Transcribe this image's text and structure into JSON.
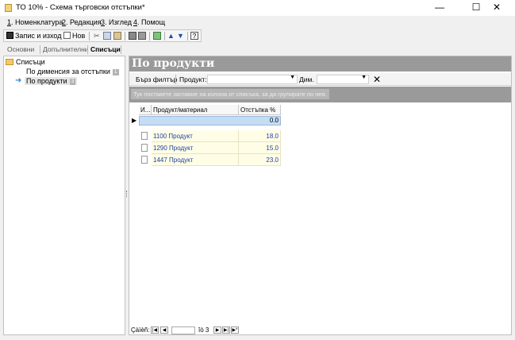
{
  "window": {
    "title": "ТО 10% - Схема търговски отстъпки*"
  },
  "menu": [
    {
      "key": "1",
      "label": ". Номенклатура"
    },
    {
      "key": "2",
      "label": ". Редакция"
    },
    {
      "key": "3",
      "label": ". Изглед"
    },
    {
      "key": "4",
      "label": ". Помощ"
    }
  ],
  "toolbar": {
    "save_label": "Запис и изход",
    "new_label": "Нов"
  },
  "tabs": {
    "basic": "Основни",
    "additional": "Допълнителни",
    "lists": "Списъци"
  },
  "tree": {
    "root": "Списъци",
    "items": [
      {
        "label": "По дименсия за отстъпки",
        "badge": "1"
      },
      {
        "label": "По продукти",
        "badge": "3"
      }
    ]
  },
  "panel": {
    "title": "По продукти",
    "quick_filter": "Бърз филтър",
    "product_label": "Продукт:",
    "dim_label": "Дим.",
    "group_hint": "Тук поставете заглавие на колона от списъка, за да групирате по нея."
  },
  "grid": {
    "columns": [
      "И...",
      "Продукт/материал",
      "Отстъпка %"
    ],
    "new_row_value": "0.0",
    "rows": [
      {
        "product": "1100 Продукт",
        "discount": "18.0"
      },
      {
        "product": "1290 Продукт",
        "discount": "15.0"
      },
      {
        "product": "1447 Продукт",
        "discount": "23.0"
      }
    ]
  },
  "pager": {
    "label": "Çàïèñ:",
    "of_text": "îò 3"
  },
  "colors": {
    "header_bg": "#9a9a9a",
    "row_bg": "#fffde5",
    "new_row_bg": "#c5ddf4",
    "link": "#1c3fa6"
  }
}
